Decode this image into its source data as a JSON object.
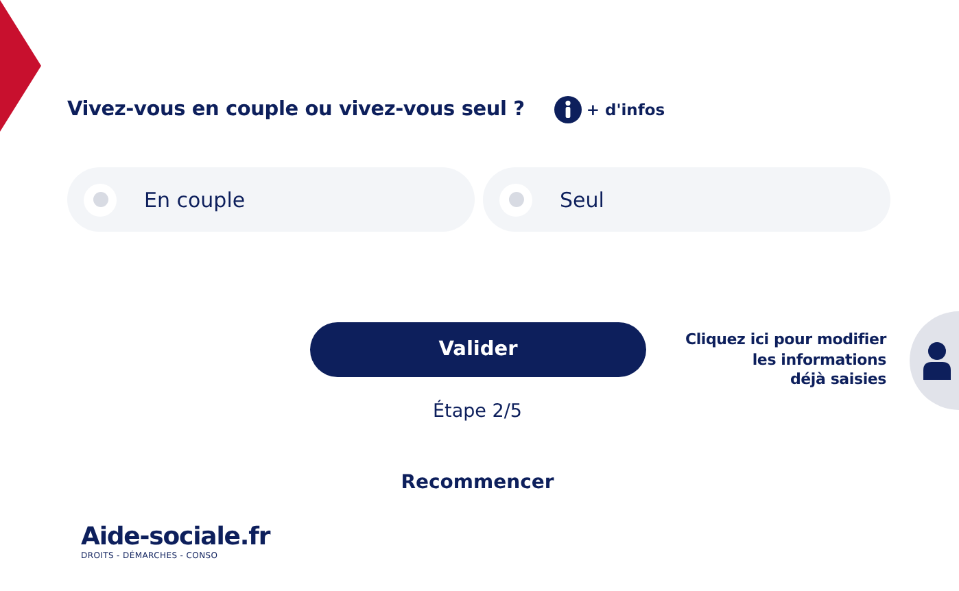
{
  "question": {
    "label": "Vivez-vous en couple ou vivez-vous seul ?",
    "info_link": "+ d'infos"
  },
  "options": [
    {
      "label": "En couple",
      "selected": false
    },
    {
      "label": "Seul",
      "selected": false
    }
  ],
  "submit_button": "Valider",
  "step": "Étape 2/5",
  "restart_link": "Recommencer",
  "edit_hint": [
    "Cliquez ici pour modifier",
    "les informations",
    "déjà saisies"
  ],
  "logo": {
    "name": "Aide-sociale.fr",
    "tagline": "DROITS - DÉMARCHES - CONSO"
  }
}
